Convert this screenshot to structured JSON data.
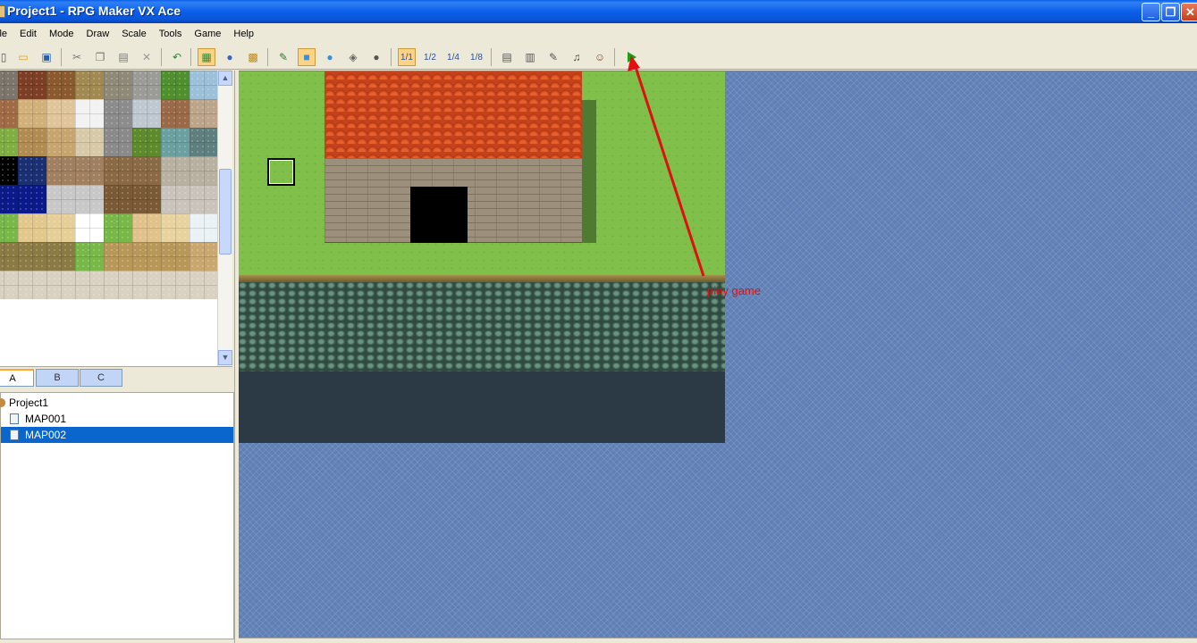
{
  "window": {
    "title": "Project1 - RPG Maker VX Ace",
    "controls": {
      "minimize": "_",
      "maximize": "❐",
      "close": "✕"
    }
  },
  "menu": [
    "ile",
    "Edit",
    "Mode",
    "Draw",
    "Scale",
    "Tools",
    "Game",
    "Help"
  ],
  "toolbar": [
    {
      "name": "new-project-icon",
      "glyph": "▯"
    },
    {
      "name": "open-project-icon",
      "glyph": "▭"
    },
    {
      "name": "save-project-icon",
      "glyph": "▣"
    },
    {
      "name": "cut-icon",
      "glyph": "✂"
    },
    {
      "name": "copy-icon",
      "glyph": "❐"
    },
    {
      "name": "paste-icon",
      "glyph": "▤"
    },
    {
      "name": "delete-icon",
      "glyph": "✕"
    },
    {
      "name": "undo-icon",
      "glyph": "↶"
    },
    {
      "name": "map-mode-icon",
      "glyph": "▦"
    },
    {
      "name": "event-mode-icon",
      "glyph": "●"
    },
    {
      "name": "region-mode-icon",
      "glyph": "▩"
    },
    {
      "name": "pencil-icon",
      "glyph": "✎"
    },
    {
      "name": "rectangle-icon",
      "glyph": "■"
    },
    {
      "name": "ellipse-icon",
      "glyph": "●"
    },
    {
      "name": "flood-fill-icon",
      "glyph": "◈"
    },
    {
      "name": "shadow-pen-icon",
      "glyph": "●"
    },
    {
      "name": "scale-1-1-icon",
      "glyph": "1/1"
    },
    {
      "name": "scale-1-2-icon",
      "glyph": "1/2"
    },
    {
      "name": "scale-1-4-icon",
      "glyph": "1/4"
    },
    {
      "name": "scale-1-8-icon",
      "glyph": "1/8"
    },
    {
      "name": "database-icon",
      "glyph": "▤"
    },
    {
      "name": "resource-manager-icon",
      "glyph": "▥"
    },
    {
      "name": "script-editor-icon",
      "glyph": "✎"
    },
    {
      "name": "sound-test-icon",
      "glyph": "♫"
    },
    {
      "name": "character-generator-icon",
      "glyph": "☺"
    },
    {
      "name": "play-test-icon",
      "glyph": ""
    }
  ],
  "tile_tabs": [
    "A",
    "B",
    "C"
  ],
  "map_tree": {
    "project": "Project1",
    "maps": [
      "MAP001",
      "MAP002"
    ],
    "selected": "MAP002"
  },
  "annotation": {
    "text": "play game",
    "color": "#e01010"
  },
  "colors": {
    "titlebar": "#0a5ee8",
    "selection": "#0a66cc",
    "map_background": "#5f7fb5",
    "grass": "#7fbf4a",
    "roof": "#c4431b"
  }
}
